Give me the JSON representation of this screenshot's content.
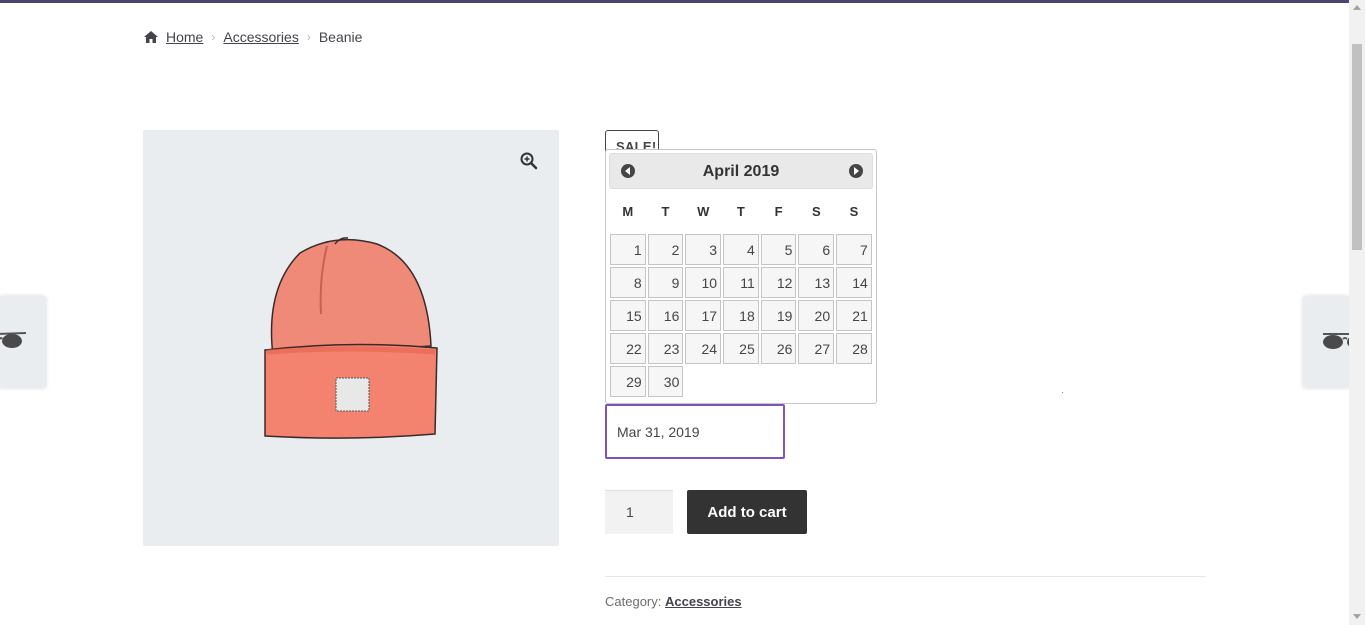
{
  "breadcrumb": {
    "home": "Home",
    "category": "Accessories",
    "current": "Beanie"
  },
  "product": {
    "sale_badge": "SALE!",
    "image_alt": "Beanie"
  },
  "datepicker": {
    "title": "April 2019",
    "weekdays": [
      "M",
      "T",
      "W",
      "T",
      "F",
      "S",
      "S"
    ],
    "days": [
      "1",
      "2",
      "3",
      "4",
      "5",
      "6",
      "7",
      "8",
      "9",
      "10",
      "11",
      "12",
      "13",
      "14",
      "15",
      "16",
      "17",
      "18",
      "19",
      "20",
      "21",
      "22",
      "23",
      "24",
      "25",
      "26",
      "27",
      "28",
      "29",
      "30"
    ]
  },
  "form": {
    "date_value": "Mar 31, 2019",
    "quantity": "1",
    "add_to_cart": "Add to cart"
  },
  "meta": {
    "category_label": "Category:",
    "category_value": "Accessories"
  },
  "colors": {
    "accent": "#7f54b3",
    "topbar": "#4e4473",
    "button": "#333333"
  }
}
